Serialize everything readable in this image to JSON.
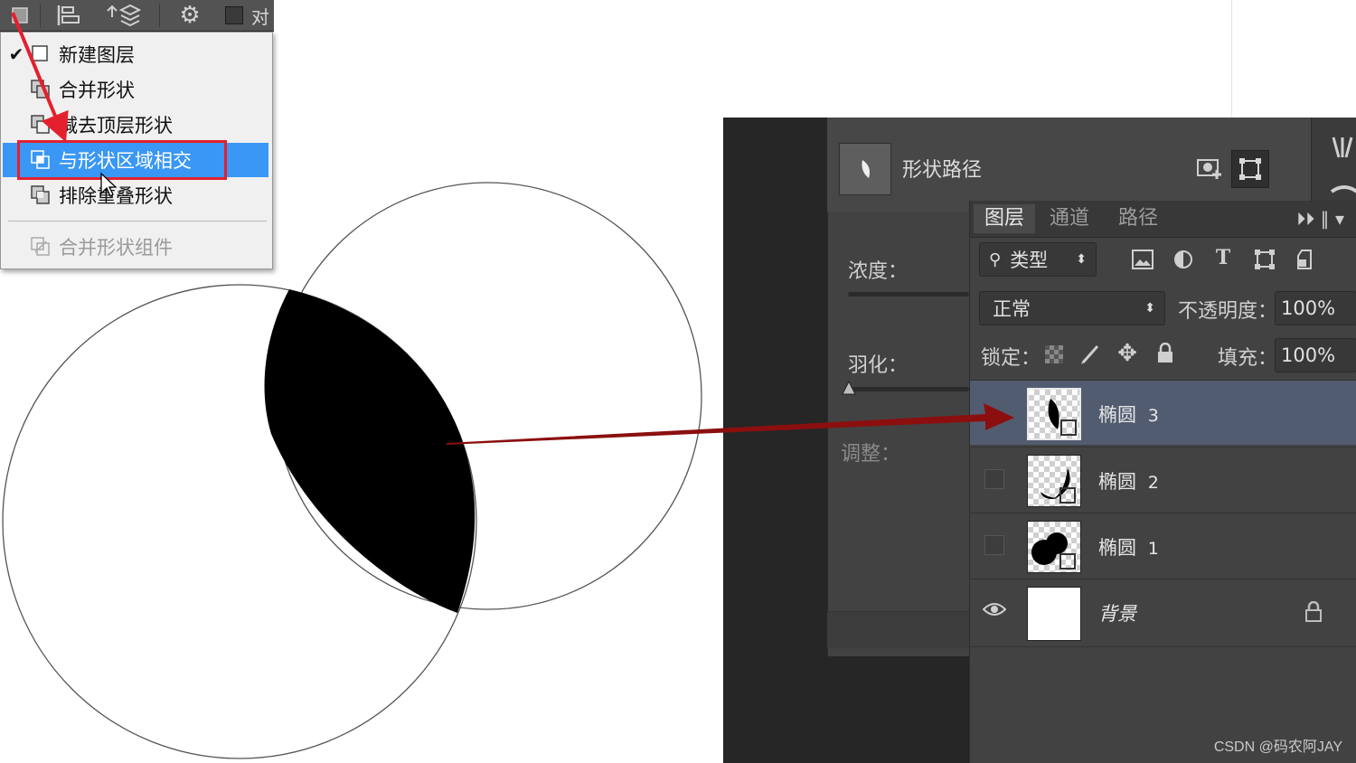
{
  "toolbar": {
    "items": [
      "path-operations-icon",
      "path-alignment-icon",
      "path-arrangement-icon",
      "gear-icon",
      "checkbox"
    ],
    "truncated_label": "对"
  },
  "menu": {
    "items": [
      {
        "label": "新建图层",
        "checked": true,
        "state": "normal"
      },
      {
        "label": "合并形状",
        "checked": false,
        "state": "normal"
      },
      {
        "label": "减去顶层形状",
        "checked": false,
        "state": "normal"
      },
      {
        "label": "与形状区域相交",
        "checked": false,
        "state": "highlighted"
      },
      {
        "label": "排除重叠形状",
        "checked": false,
        "state": "normal"
      },
      {
        "label": "合并形状组件",
        "checked": false,
        "state": "disabled"
      }
    ],
    "check_glyph": "✔"
  },
  "properties": {
    "title": "形状路径",
    "density_label": "浓度：",
    "feather_label": "羽化：",
    "adjust_label": "调整："
  },
  "layers_panel": {
    "tabs": [
      "图层",
      "通道",
      "路径"
    ],
    "active_tab": 0,
    "filter": {
      "label": "类型"
    },
    "blend_mode": "正常",
    "opacity": {
      "label": "不透明度：",
      "value": "100%"
    },
    "lock_label": "锁定：",
    "fill": {
      "label": "填充：",
      "value": "100%"
    },
    "layers": [
      {
        "name": "椭圆",
        "number": "3",
        "selected": true,
        "visible": false
      },
      {
        "name": "椭圆",
        "number": "2",
        "selected": false,
        "visible": false
      },
      {
        "name": "椭圆",
        "number": "1",
        "selected": false,
        "visible": false
      },
      {
        "name": "背景",
        "number": "",
        "selected": false,
        "visible": true,
        "locked": true
      }
    ]
  },
  "watermark": "CSDN @码农阿JAY",
  "colors": {
    "highlight": "#3a97f5",
    "annotation_red": "#e4202e",
    "arrow_dark_red": "#8b0f0f",
    "selected_layer": "#525c70"
  }
}
